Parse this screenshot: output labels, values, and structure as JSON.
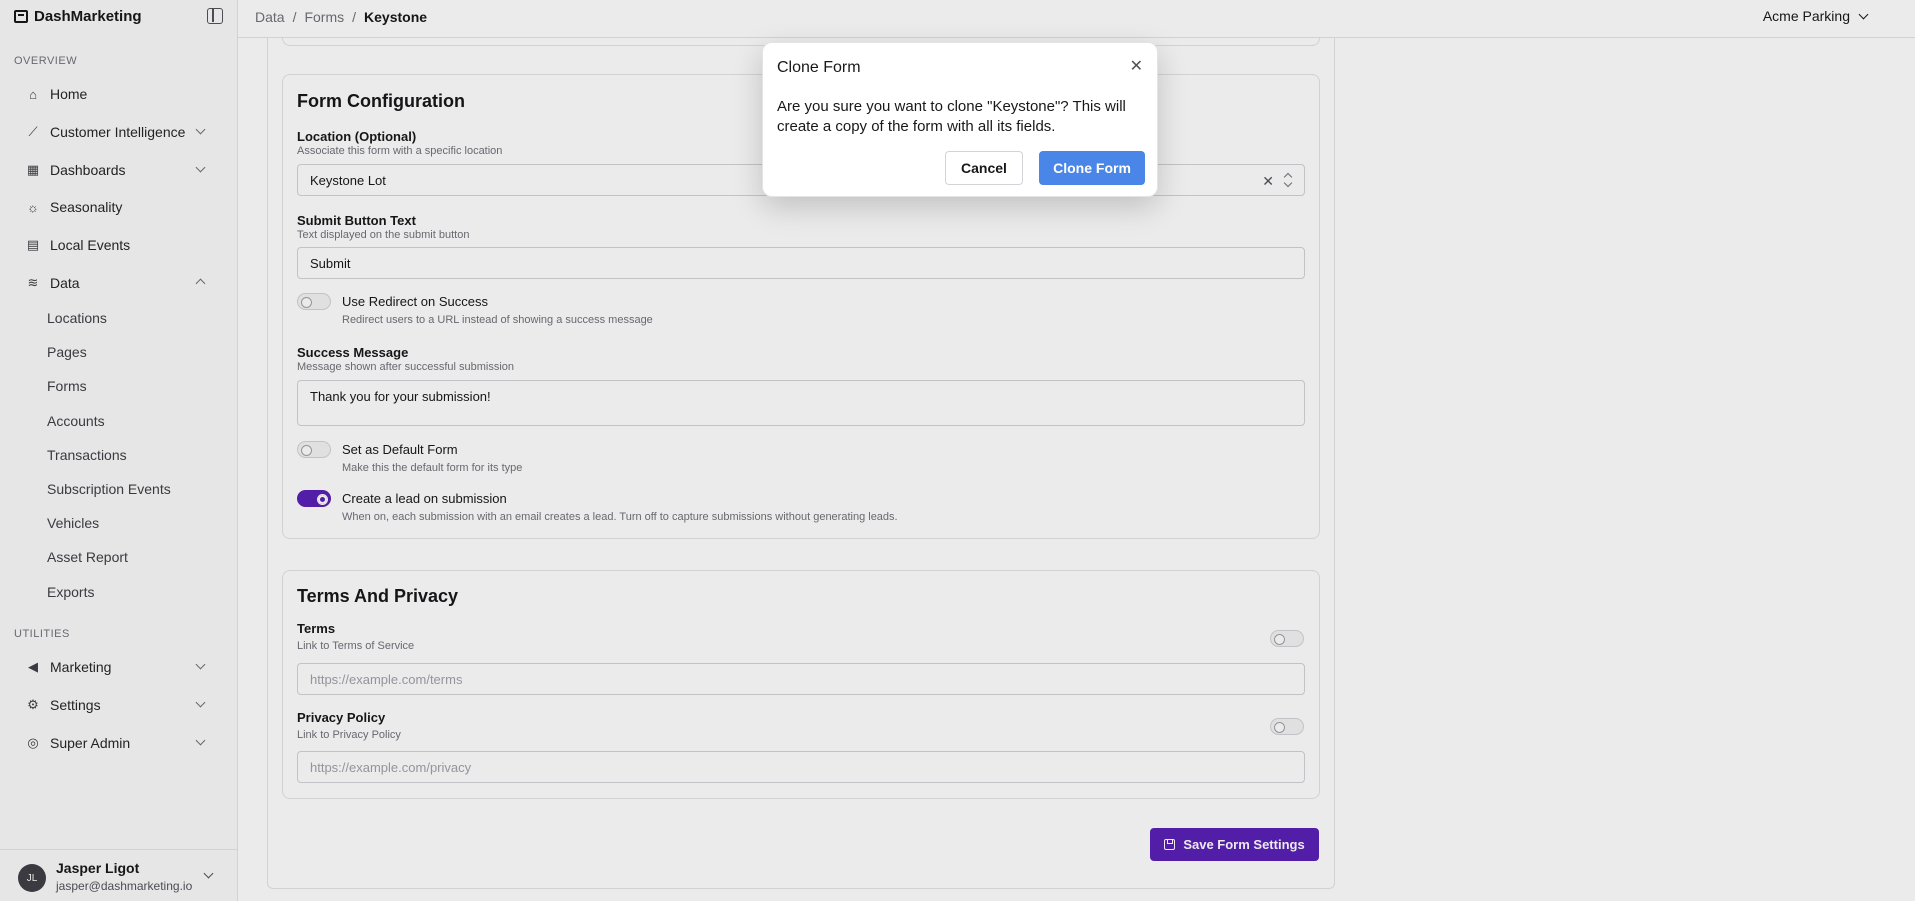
{
  "brand": {
    "name": "DashMarketing"
  },
  "sidebar": {
    "overview_label": "OVERVIEW",
    "utilities_label": "UTILITIES",
    "items": [
      {
        "label": "Home",
        "icon": "home-icon"
      },
      {
        "label": "Customer Intelligence",
        "icon": "trend-icon"
      },
      {
        "label": "Dashboards",
        "icon": "grid-icon"
      },
      {
        "label": "Seasonality",
        "icon": "sun-icon"
      },
      {
        "label": "Local Events",
        "icon": "calendar-icon"
      },
      {
        "label": "Data",
        "icon": "database-icon"
      }
    ],
    "data_subitems": [
      "Locations",
      "Pages",
      "Forms",
      "Accounts",
      "Transactions",
      "Subscription Events",
      "Vehicles",
      "Asset Report",
      "Exports"
    ],
    "utility_items": [
      {
        "label": "Marketing",
        "icon": "megaphone-icon"
      },
      {
        "label": "Settings",
        "icon": "gear-icon"
      },
      {
        "label": "Super Admin",
        "icon": "admin-icon"
      }
    ]
  },
  "user": {
    "initials": "JL",
    "name": "Jasper Ligot",
    "email": "jasper@dashmarketing.io"
  },
  "header": {
    "breadcrumbs": [
      "Data",
      "Forms",
      "Keystone"
    ],
    "separator": "/",
    "org": "Acme Parking"
  },
  "form_config": {
    "title": "Form Configuration",
    "location_label": "Location (Optional)",
    "location_desc": "Associate this form with a specific location",
    "location_value": "Keystone Lot",
    "submit_label": "Submit Button Text",
    "submit_desc": "Text displayed on the submit button",
    "submit_value": "Submit",
    "redirect_label": "Use Redirect on Success",
    "redirect_desc": "Redirect users to a URL instead of showing a success message",
    "success_label": "Success Message",
    "success_desc": "Message shown after successful submission",
    "success_value": "Thank you for your submission!",
    "default_label": "Set as Default Form",
    "default_desc": "Make this the default form for its type",
    "lead_label": "Create a lead on submission",
    "lead_desc": "When on, each submission with an email creates a lead. Turn off to capture submissions without generating leads."
  },
  "terms": {
    "title": "Terms And Privacy",
    "terms_label": "Terms",
    "terms_desc": "Link to Terms of Service",
    "terms_placeholder": "https://example.com/terms",
    "privacy_label": "Privacy Policy",
    "privacy_desc": "Link to Privacy Policy",
    "privacy_placeholder": "https://example.com/privacy"
  },
  "save_label": "Save Form Settings",
  "dialog": {
    "title": "Clone Form",
    "close": "✕",
    "body": "Are you sure you want to clone \"Keystone\"? This will create a copy of the form with all its fields.",
    "cancel": "Cancel",
    "confirm": "Clone Form"
  },
  "colors": {
    "primary": "#5b21b6",
    "dialog_confirm": "#4a86e8"
  }
}
